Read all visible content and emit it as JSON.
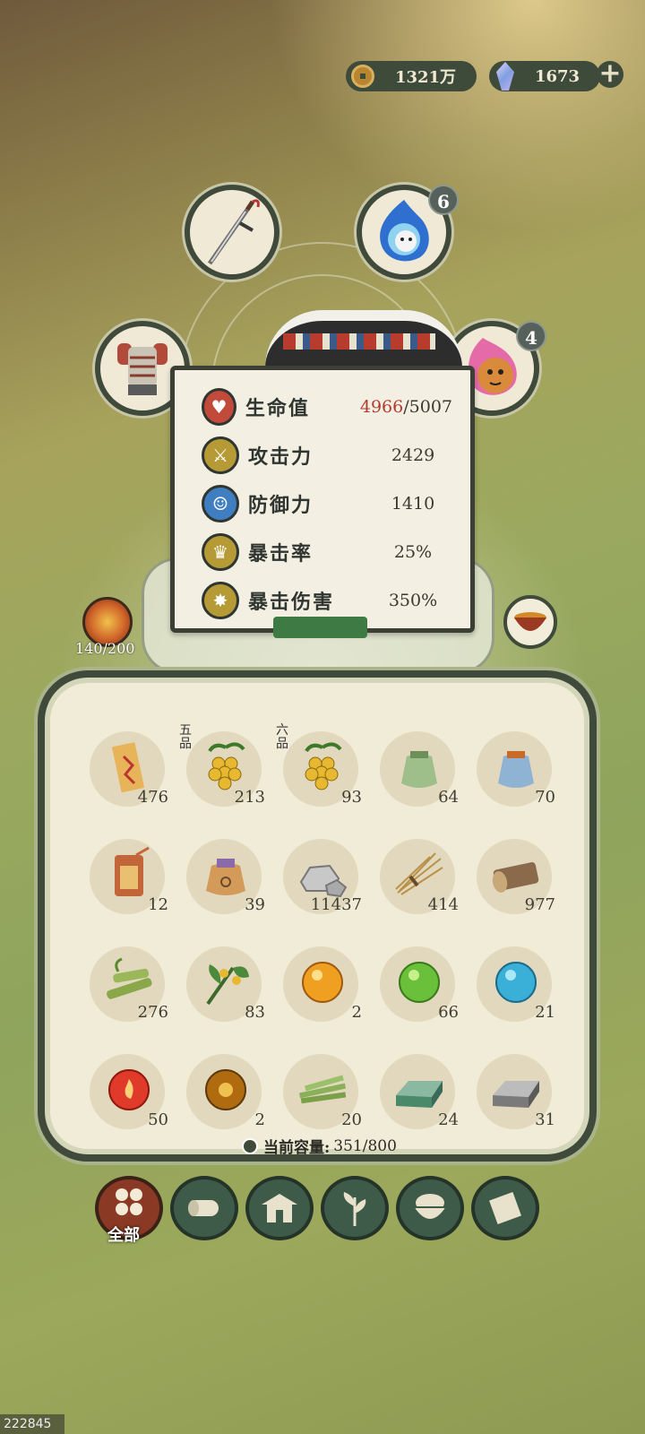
{
  "currency": {
    "coins": "1321万",
    "gems": "1673",
    "coin_icon": "copper-coin-icon",
    "gem_icon": "crystal-gem-icon"
  },
  "equipment": {
    "slots": [
      {
        "name": "weapon",
        "icon": "sword-icon"
      },
      {
        "name": "spirit-blue",
        "icon": "ghost-spirit-icon",
        "badge": "6"
      },
      {
        "name": "armor",
        "icon": "armor-icon"
      },
      {
        "name": "spirit-red",
        "icon": "tiger-spirit-icon",
        "badge": "4"
      }
    ]
  },
  "stats": {
    "hp_label": "生命值",
    "hp_current": "4966",
    "hp_max": "/5007",
    "atk_label": "攻击力",
    "atk_value": "2429",
    "def_label": "防御力",
    "def_value": "1410",
    "crit_label": "暴击率",
    "crit_value": "25%",
    "critdmg_label": "暴击伤害",
    "critdmg_value": "350%"
  },
  "hunger": "140/200",
  "colors": {
    "accent": "#3f4a3b",
    "hp_red": "#b23b2f",
    "active_tab": "#8a3a24"
  },
  "inventory": {
    "items": [
      {
        "icon": "talisman-scroll-icon",
        "count": "476"
      },
      {
        "icon": "golden-berries-icon",
        "count": "213",
        "grade": "五品"
      },
      {
        "icon": "golden-berries-icon",
        "count": "93",
        "grade": "六品"
      },
      {
        "icon": "green-pouch-icon",
        "count": "64"
      },
      {
        "icon": "blue-pouch-icon",
        "count": "70"
      },
      {
        "icon": "tag-token-icon",
        "count": "12"
      },
      {
        "icon": "orange-pouch-icon",
        "count": "39"
      },
      {
        "icon": "stone-icon",
        "count": "11437"
      },
      {
        "icon": "straw-bundle-icon",
        "count": "414"
      },
      {
        "icon": "log-icon",
        "count": "977"
      },
      {
        "icon": "bamboo-icon",
        "count": "276"
      },
      {
        "icon": "herb-flower-icon",
        "count": "83"
      },
      {
        "icon": "orange-orb-icon",
        "count": "2"
      },
      {
        "icon": "green-orb-icon",
        "count": "66"
      },
      {
        "icon": "blue-orb-icon",
        "count": "21"
      },
      {
        "icon": "red-fire-orb-icon",
        "count": "50"
      },
      {
        "icon": "amber-orb-icon",
        "count": "2"
      },
      {
        "icon": "bamboo-strips-icon",
        "count": "20"
      },
      {
        "icon": "jade-ingot-icon",
        "count": "24"
      },
      {
        "icon": "iron-ingot-icon",
        "count": "31"
      }
    ],
    "capacity_label": "当前容量:",
    "capacity_value": "351/800"
  },
  "tabs": [
    {
      "label": "全部",
      "icon": "all-grid-icon",
      "active": true
    },
    {
      "label": "",
      "icon": "wood-log-icon"
    },
    {
      "label": "",
      "icon": "house-icon"
    },
    {
      "label": "",
      "icon": "herb-leaf-icon"
    },
    {
      "label": "",
      "icon": "rice-bowl-icon"
    },
    {
      "label": "",
      "icon": "scroll-icon"
    }
  ],
  "watermark": "222845"
}
